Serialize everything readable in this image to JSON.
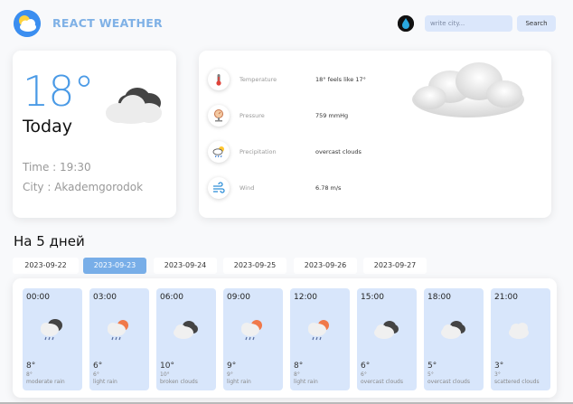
{
  "header": {
    "brand": "REACT WEATHER",
    "search_placeholder": "write city...",
    "search_button": "Search",
    "logo_icon": "sun-cloud-icon",
    "theme_icon": "water-drop-icon"
  },
  "today": {
    "temp": "18°",
    "label": "Today",
    "time": "Time : 19:30",
    "city": "City : Akademgorodok",
    "icon": "cloud-icon"
  },
  "details": [
    {
      "icon": "thermometer-icon",
      "label": "Temperature",
      "value": "18° feels like 17°"
    },
    {
      "icon": "pressure-icon",
      "label": "Pressure",
      "value": "759 mmHg"
    },
    {
      "icon": "precipitation-icon",
      "label": "Precipitation",
      "value": "overcast clouds"
    },
    {
      "icon": "wind-icon",
      "label": "Wind",
      "value": "6.78 m/s"
    }
  ],
  "forecast": {
    "title": "На 5 дней",
    "days": [
      "2023-09-22",
      "2023-09-23",
      "2023-09-24",
      "2023-09-25",
      "2023-09-26",
      "2023-09-27"
    ],
    "active_day": "2023-09-23",
    "hours": [
      {
        "time": "00:00",
        "temp": "8°",
        "feels": "8°",
        "desc": "moderate rain",
        "icon": "rain-cloud-icon"
      },
      {
        "time": "03:00",
        "temp": "6°",
        "feels": "6°",
        "desc": "light rain",
        "icon": "sun-rain-icon"
      },
      {
        "time": "06:00",
        "temp": "10°",
        "feels": "10°",
        "desc": "broken clouds",
        "icon": "broken-clouds-icon"
      },
      {
        "time": "09:00",
        "temp": "9°",
        "feels": "9°",
        "desc": "light rain",
        "icon": "sun-rain-icon"
      },
      {
        "time": "12:00",
        "temp": "8°",
        "feels": "8°",
        "desc": "light rain",
        "icon": "sun-rain-icon"
      },
      {
        "time": "15:00",
        "temp": "6°",
        "feels": "6°",
        "desc": "overcast clouds",
        "icon": "overcast-clouds-icon"
      },
      {
        "time": "18:00",
        "temp": "5°",
        "feels": "5°",
        "desc": "overcast clouds",
        "icon": "overcast-clouds-icon"
      },
      {
        "time": "21:00",
        "temp": "3°",
        "feels": "3°",
        "desc": "scattered clouds",
        "icon": "cloud-icon"
      }
    ]
  },
  "colors": {
    "accent": "#4a9ae6",
    "brand": "#7fb1e6",
    "active_tab": "#78aee8",
    "hour_card": "#d8e6fb",
    "input_bg": "#dbe7fb"
  }
}
